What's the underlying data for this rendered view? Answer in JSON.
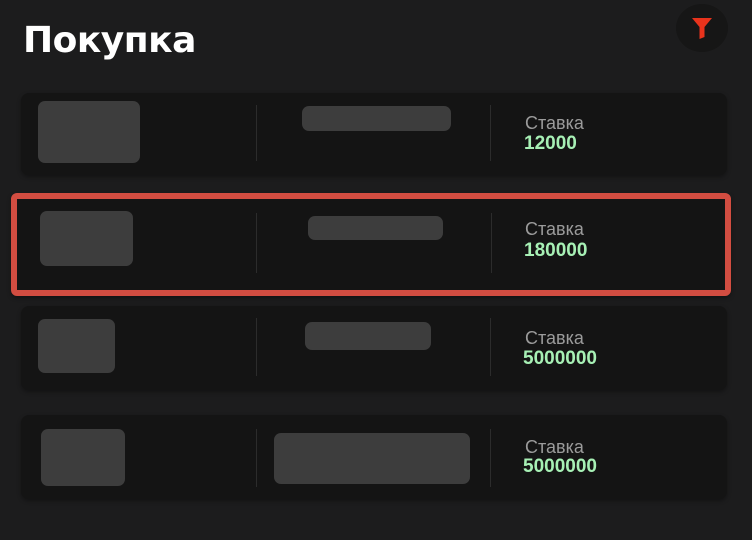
{
  "header": {
    "title": "Покупка",
    "filter_icon": "filter-funnel-icon",
    "filter_icon_color": "#e8331c"
  },
  "listings": [
    {
      "bet_label": "Ставка",
      "bet_value": "12000",
      "selected": false
    },
    {
      "bet_label": "Ставка",
      "bet_value": "180000",
      "selected": true
    },
    {
      "bet_label": "Ставка",
      "bet_value": "5000000",
      "selected": false
    },
    {
      "bet_label": "Ставка",
      "bet_value": "5000000",
      "selected": false
    }
  ],
  "colors": {
    "background": "#1c1c1d",
    "card": "#141414",
    "placeholder": "#3d3d3d",
    "bet_value": "#a7f0b5",
    "highlight_border": "#d24d41"
  }
}
